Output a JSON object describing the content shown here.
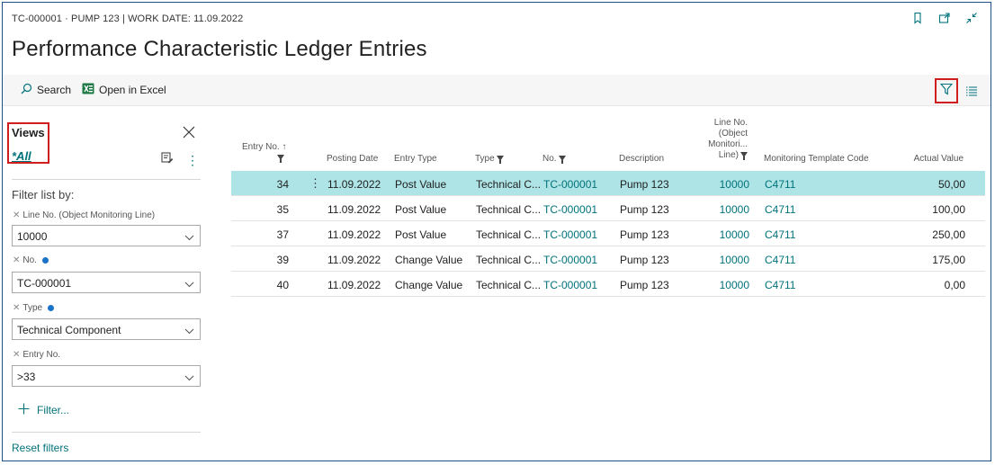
{
  "header": {
    "context": "TC-000001 · PUMP 123 | WORK DATE: 11.09.2022",
    "title": "Performance Characteristic Ledger Entries"
  },
  "actions": {
    "search": "Search",
    "open_excel": "Open in Excel"
  },
  "filter_pane": {
    "views_title": "Views",
    "view_all": "*All",
    "filter_by": "Filter list by:",
    "filters": [
      {
        "label": "Line No. (Object Monitoring Line)",
        "value": "10000",
        "info": false
      },
      {
        "label": "No.",
        "value": "TC-000001",
        "info": true
      },
      {
        "label": "Type",
        "value": "Technical Component",
        "info": true
      },
      {
        "label": "Entry No.",
        "value": ">33",
        "info": false
      }
    ],
    "add_filter": "Filter...",
    "reset": "Reset filters"
  },
  "table": {
    "columns": {
      "entry_no": "Entry No. ↑",
      "posting_date": "Posting Date",
      "entry_type": "Entry Type",
      "type": "Type",
      "no": "No.",
      "description": "Description",
      "line_no_1": "Line No.",
      "line_no_2": "(Object",
      "line_no_3": "Monitori...",
      "line_no_4": "Line)",
      "template": "Monitoring Template Code",
      "actual_value": "Actual Value"
    },
    "rows": [
      {
        "entry_no": "34",
        "posting_date": "11.09.2022",
        "entry_type": "Post Value",
        "type": "Technical C...",
        "no": "TC-000001",
        "description": "Pump 123",
        "line_no": "10000",
        "template": "C4711",
        "actual_value": "50,00"
      },
      {
        "entry_no": "35",
        "posting_date": "11.09.2022",
        "entry_type": "Post Value",
        "type": "Technical C...",
        "no": "TC-000001",
        "description": "Pump 123",
        "line_no": "10000",
        "template": "C4711",
        "actual_value": "100,00"
      },
      {
        "entry_no": "37",
        "posting_date": "11.09.2022",
        "entry_type": "Post Value",
        "type": "Technical C...",
        "no": "TC-000001",
        "description": "Pump 123",
        "line_no": "10000",
        "template": "C4711",
        "actual_value": "250,00"
      },
      {
        "entry_no": "39",
        "posting_date": "11.09.2022",
        "entry_type": "Change Value",
        "type": "Technical C...",
        "no": "TC-000001",
        "description": "Pump 123",
        "line_no": "10000",
        "template": "C4711",
        "actual_value": "175,00"
      },
      {
        "entry_no": "40",
        "posting_date": "11.09.2022",
        "entry_type": "Change Value",
        "type": "Technical C...",
        "no": "TC-000001",
        "description": "Pump 123",
        "line_no": "10000",
        "template": "C4711",
        "actual_value": "0,00"
      }
    ],
    "row_menu": "⋮"
  },
  "colors": {
    "accent": "#00727a",
    "selected_row": "#aee4e6",
    "highlight_border": "#d01e1e"
  },
  "icons": [
    "bookmark-icon",
    "open-new-window-icon",
    "collapse-icon",
    "search-icon",
    "excel-icon",
    "filter-icon",
    "list-view-icon",
    "close-icon",
    "save-view-icon",
    "more-options-icon",
    "chevron-down-icon",
    "add-icon",
    "info-icon"
  ]
}
